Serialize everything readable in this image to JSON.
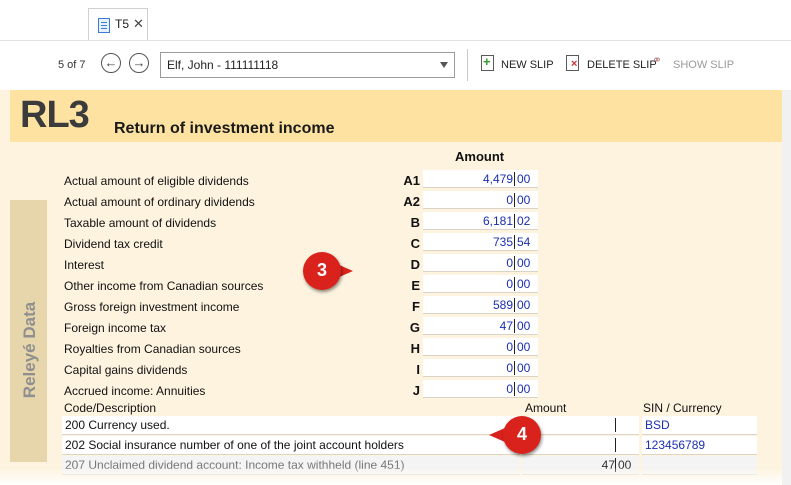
{
  "tab": {
    "label": "T5",
    "close": "✕"
  },
  "toolbar": {
    "position": "5 of 7",
    "prev_icon": "←",
    "next_icon": "→",
    "recipient_value": "Elf, John - 111111118",
    "new_slip": "NEW SLIP",
    "delete_slip": "DELETE SLIP",
    "show_slip": "SHOW SLIP"
  },
  "form": {
    "code": "RL3",
    "title": "Return of investment income",
    "sidebar_label": "Releyé Data",
    "amount_header": "Amount",
    "rows": [
      {
        "label": "Actual amount of eligible dividends",
        "code": "A1",
        "dollars": "4,479",
        "cents": "00"
      },
      {
        "label": "Actual amount of ordinary dividends",
        "code": "A2",
        "dollars": "0",
        "cents": "00"
      },
      {
        "label": "Taxable amount of dividends",
        "code": "B",
        "dollars": "6,181",
        "cents": "02"
      },
      {
        "label": "Dividend tax credit",
        "code": "C",
        "dollars": "735",
        "cents": "54"
      },
      {
        "label": "Interest",
        "code": "D",
        "dollars": "0",
        "cents": "00"
      },
      {
        "label": "Other income from Canadian sources",
        "code": "E",
        "dollars": "0",
        "cents": "00"
      },
      {
        "label": "Gross foreign investment income",
        "code": "F",
        "dollars": "589",
        "cents": "00"
      },
      {
        "label": "Foreign income tax",
        "code": "G",
        "dollars": "47",
        "cents": "00"
      },
      {
        "label": "Royalties from Canadian sources",
        "code": "H",
        "dollars": "0",
        "cents": "00"
      },
      {
        "label": "Capital gains dividends",
        "code": "I",
        "dollars": "0",
        "cents": "00"
      },
      {
        "label": "Accrued income: Annuities",
        "code": "J",
        "dollars": "0",
        "cents": "00"
      }
    ],
    "codes_header": {
      "description": "Code/Description",
      "amount": "Amount",
      "sin": "SIN / Currency"
    },
    "code_rows": [
      {
        "description": "200 Currency used.",
        "dollars": "",
        "cents": "",
        "sin": "BSD"
      },
      {
        "description": "202 Social insurance number of one of the joint account holders",
        "dollars": "",
        "cents": "",
        "sin": "123456789"
      },
      {
        "description": "207 Unclaimed dividend account: Income tax withheld (line 451)",
        "dollars": "47",
        "cents": "00",
        "sin": ""
      }
    ]
  },
  "callouts": {
    "c3": "3",
    "c4": "4"
  },
  "colors": {
    "header_band": "#fde2a2",
    "body_band": "#fdf3df",
    "sidebar": "#e7d6ab",
    "value_text": "#1a2fb0",
    "callout": "#d9221b"
  }
}
